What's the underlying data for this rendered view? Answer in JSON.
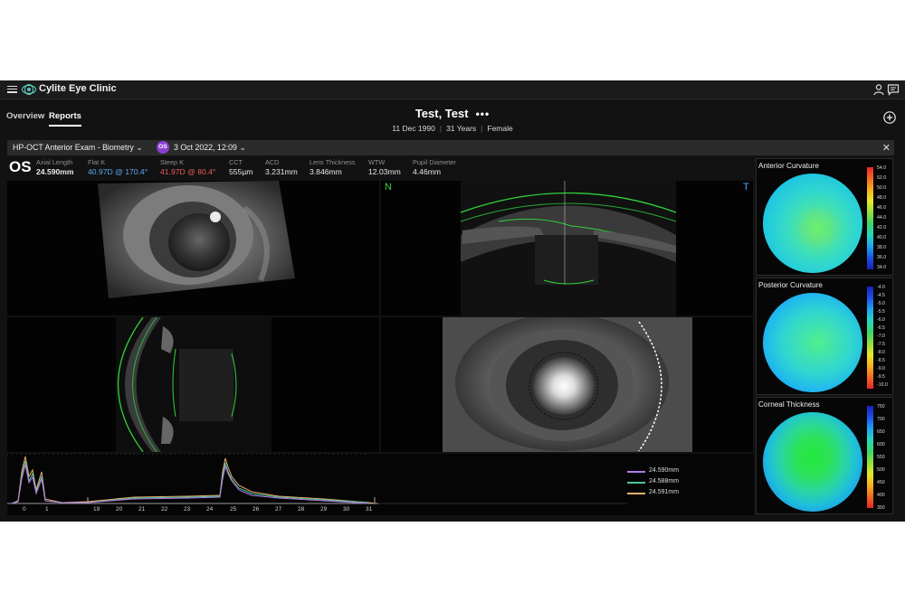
{
  "app": {
    "brand": "Cylite Eye Clinic"
  },
  "nav": {
    "tabs": [
      {
        "label": "Overview"
      },
      {
        "label": "Reports"
      }
    ]
  },
  "patient": {
    "name": "Test, Test",
    "more": "•••",
    "dob": "11 Dec 1990",
    "age": "31 Years",
    "sex": "Female"
  },
  "exam": {
    "name": "HP-OCT Anterior Exam - Biometry",
    "eye_badge": "OS",
    "date": "3 Oct 2022, 12:09",
    "close": "✕"
  },
  "metrics": {
    "eye": "OS",
    "items": [
      {
        "label": "Axial Length",
        "value": "24.590mm"
      },
      {
        "label": "Flat K",
        "value": "40.97D @ 170.4°"
      },
      {
        "label": "Steep K",
        "value": "41.97D @ 80.4°"
      },
      {
        "label": "CCT",
        "value": "555µm"
      },
      {
        "label": "ACD",
        "value": "3.231mm"
      },
      {
        "label": "Lens Thickness",
        "value": "3.846mm"
      },
      {
        "label": "WTW",
        "value": "12.03mm"
      },
      {
        "label": "Pupil Diameter",
        "value": "4.46mm"
      }
    ]
  },
  "scan": {
    "nasal": "N",
    "temporal": "T"
  },
  "maps": [
    {
      "title": "Anterior Curvature",
      "ticks": [
        "54.0",
        "52.0",
        "50.0",
        "48.0",
        "46.0",
        "44.0",
        "42.0",
        "40.0",
        "38.0",
        "36.0",
        "34.0"
      ]
    },
    {
      "title": "Posterior Curvature",
      "ticks": [
        "-4.0",
        "-4.5",
        "-5.0",
        "-5.5",
        "-6.0",
        "-6.5",
        "-7.0",
        "-7.5",
        "-8.0",
        "-8.5",
        "-9.0",
        "-9.5",
        "-10.0"
      ]
    },
    {
      "title": "Corneal Thickness",
      "ticks": [
        "750",
        "700",
        "650",
        "600",
        "550",
        "500",
        "450",
        "400",
        "350"
      ]
    }
  ],
  "graph": {
    "x_ticks": [
      "0",
      "1",
      "19",
      "20",
      "21",
      "22",
      "23",
      "24",
      "25",
      "26",
      "27",
      "28",
      "29",
      "30",
      "31"
    ],
    "legend": [
      {
        "label": "24.590mm",
        "color": "#b57be8"
      },
      {
        "label": "24.588mm",
        "color": "#4fc3a1"
      },
      {
        "label": "24.591mm",
        "color": "#e8b06a"
      }
    ]
  },
  "colors": {
    "accent_blue": "#5aa9f5",
    "accent_red": "#ec5a5a",
    "badge_purple": "#8a3fd1",
    "scan_green": "#35d13a"
  }
}
